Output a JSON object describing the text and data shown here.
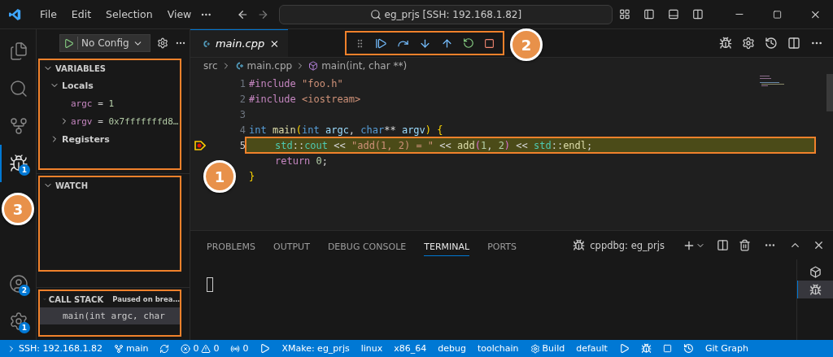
{
  "menu": [
    "File",
    "Edit",
    "Selection",
    "View"
  ],
  "command_center": "eg_prjs [SSH: 192.168.1.82]",
  "activity_bar": [
    {
      "kind": "explorer",
      "selected": false
    },
    {
      "kind": "search",
      "selected": false
    },
    {
      "kind": "scm",
      "selected": false
    },
    {
      "kind": "debug",
      "selected": true,
      "badge": "1"
    }
  ],
  "activity_bottom": [
    {
      "kind": "accounts",
      "badge": "2"
    },
    {
      "kind": "manage",
      "badge": "1"
    }
  ],
  "sidebar": {
    "launch_config": "No Config",
    "sections": [
      {
        "title": "VARIABLES",
        "expanded": true,
        "highlighted": true,
        "items": [
          {
            "label": "Locals",
            "expanded": true,
            "children": [
              {
                "name": "argc",
                "separator": "=",
                "value": "1"
              },
              {
                "name": "argv",
                "separator": "=",
                "value": "0x7fffffffd8…",
                "expandable": true
              }
            ]
          },
          {
            "label": "Registers",
            "expanded": false
          }
        ]
      },
      {
        "title": "WATCH",
        "expanded": true,
        "highlighted": true
      },
      {
        "title": "CALL STACK",
        "expanded": true,
        "highlighted": true,
        "status": "Paused on brea…",
        "frames": [
          {
            "label": "main(int argc, char",
            "selected": true
          }
        ]
      }
    ]
  },
  "editor": {
    "tabs": [
      {
        "label": "main.cpp",
        "selected": true
      }
    ],
    "debug_toolbar": {
      "highlighted": true
    },
    "breadcrumb": [
      "src",
      "main.cpp",
      "main(int, char **)"
    ],
    "lines": [
      {
        "number": "1",
        "tokens": [
          {
            "text": "#include ",
            "kind": "pre"
          },
          {
            "text": "\"foo.h\"",
            "kind": "str"
          }
        ]
      },
      {
        "number": "2",
        "tokens": [
          {
            "text": "#include ",
            "kind": "pre"
          },
          {
            "text": "<iostream>",
            "kind": "str"
          }
        ]
      },
      {
        "number": "3"
      },
      {
        "number": "4",
        "tokens": [
          {
            "text": "int ",
            "kind": "kw"
          },
          {
            "text": "main",
            "kind": "fn"
          },
          {
            "text": "(",
            "kind": "brace"
          },
          {
            "text": "int ",
            "kind": "kw"
          },
          {
            "text": "argc",
            "kind": "var"
          },
          {
            "text": ", ",
            "kind": "plain"
          },
          {
            "text": "char",
            "kind": "kw"
          },
          {
            "text": "** ",
            "kind": "plain"
          },
          {
            "text": "argv",
            "kind": "var"
          },
          {
            "text": ") {",
            "kind": "brace"
          }
        ]
      },
      {
        "number": "5",
        "current": true,
        "highlighted": true,
        "indented": true,
        "tokens": [
          {
            "text": "std",
            "kind": "ns"
          },
          {
            "text": "::",
            "kind": "plain"
          },
          {
            "text": "cout",
            "kind": "ns"
          },
          {
            "text": " << ",
            "kind": "plain"
          },
          {
            "text": "\"add(1, 2) = \"",
            "kind": "str"
          },
          {
            "text": " << ",
            "kind": "plain"
          },
          {
            "text": "add",
            "kind": "fn"
          },
          {
            "text": "(",
            "kind": "paren"
          },
          {
            "text": "1",
            "kind": "num"
          },
          {
            "text": ", ",
            "kind": "plain"
          },
          {
            "text": "2",
            "kind": "num"
          },
          {
            "text": ")",
            "kind": "paren"
          },
          {
            "text": " << ",
            "kind": "plain"
          },
          {
            "text": "std",
            "kind": "ns"
          },
          {
            "text": "::",
            "kind": "plain"
          },
          {
            "text": "endl",
            "kind": "fn"
          },
          {
            "text": ";",
            "kind": "plain"
          }
        ]
      },
      {
        "indented": true,
        "tokens": [
          {
            "text": "return ",
            "kind": "pre"
          },
          {
            "text": "0",
            "kind": "num"
          },
          {
            "text": ";",
            "kind": "plain"
          }
        ]
      },
      {
        "tokens": [
          {
            "text": "}",
            "kind": "brace"
          }
        ]
      }
    ]
  },
  "panel": {
    "tabs": [
      {
        "label": "PROBLEMS",
        "selected": false
      },
      {
        "label": "OUTPUT",
        "selected": false
      },
      {
        "label": "DEBUG CONSOLE",
        "selected": false
      },
      {
        "label": "TERMINAL",
        "selected": true
      },
      {
        "label": "PORTS",
        "selected": false
      }
    ],
    "terminal_name": "cppdbg: eg_prjs",
    "terminals": [
      {
        "kind": "shell",
        "selected": false
      },
      {
        "kind": "debug",
        "selected": true
      }
    ]
  },
  "annotations": [
    {
      "label": "1"
    },
    {
      "label": "2"
    },
    {
      "label": "3"
    }
  ],
  "status_bar": [
    {
      "kind": "remote",
      "text": "SSH: 192.168.1.82"
    },
    {
      "kind": "branch",
      "text": "main"
    },
    {
      "kind": "sync"
    },
    {
      "kind": "problems",
      "errors": "0",
      "warnings": "0"
    },
    {
      "kind": "ports",
      "text": "0"
    },
    {
      "kind": "launch"
    },
    {
      "kind": "text",
      "text": "XMake: eg_prjs"
    },
    {
      "kind": "text",
      "text": "linux"
    },
    {
      "kind": "text",
      "text": "x86_64"
    },
    {
      "kind": "text",
      "text": "debug"
    },
    {
      "kind": "text",
      "text": "toolchain"
    },
    {
      "kind": "build",
      "text": "Build"
    },
    {
      "kind": "text",
      "text": "default"
    },
    {
      "kind": "run"
    },
    {
      "kind": "bug"
    },
    {
      "kind": "stop"
    },
    {
      "kind": "history"
    },
    {
      "kind": "text",
      "text": "Git Graph"
    }
  ]
}
